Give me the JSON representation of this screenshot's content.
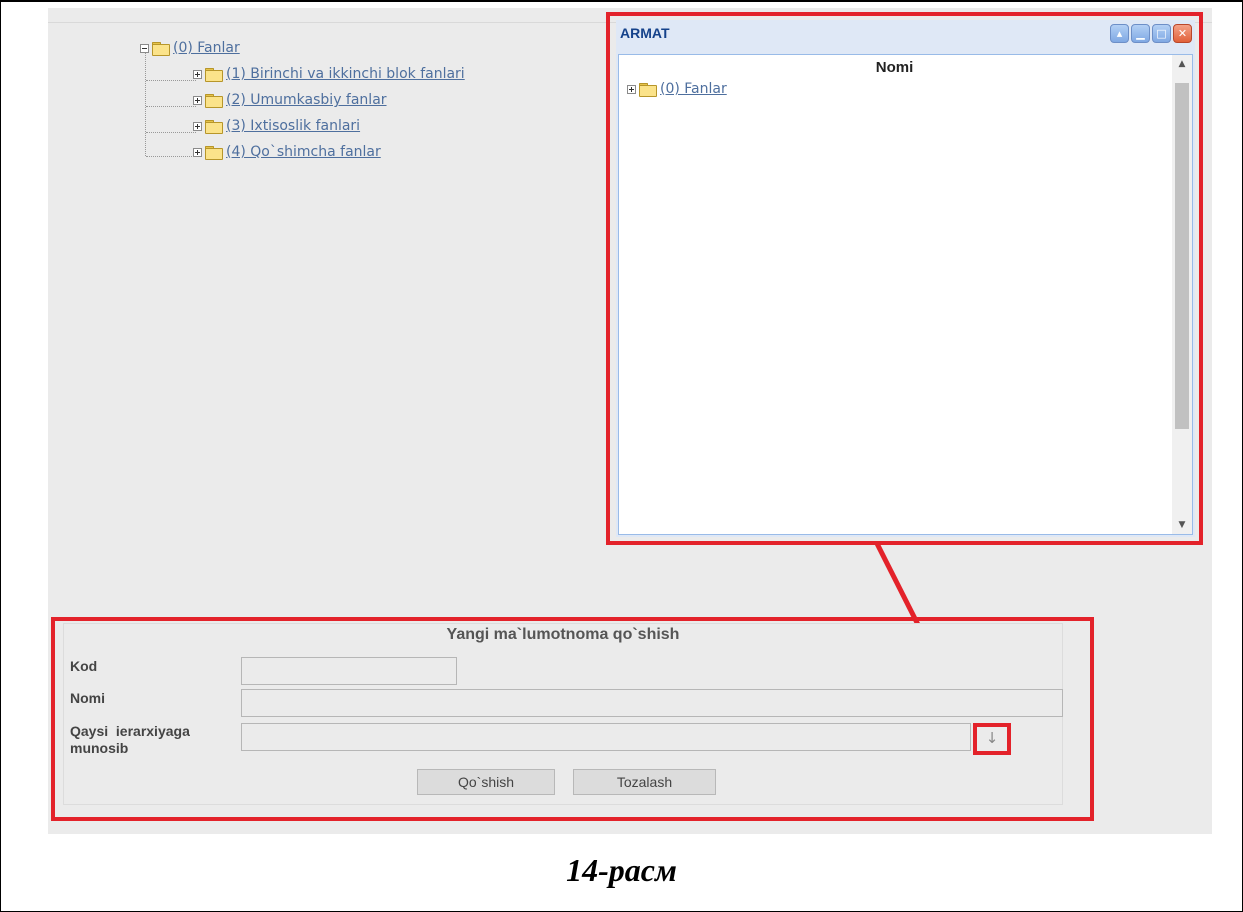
{
  "tree": {
    "root_label": "(0) Fanlar",
    "children": [
      {
        "label": "(1) Birinchi va ikkinchi blok fanlari"
      },
      {
        "label": "(2) Umumkasbiy fanlar"
      },
      {
        "label": "(3) Ixtisoslik fanlari"
      },
      {
        "label": "(4) Qo`shimcha fanlar"
      }
    ]
  },
  "popup": {
    "title": "ARMAT",
    "column_header": "Nomi",
    "root_label": "(0) Fanlar",
    "buttons": [
      "restore-icon",
      "minimize-icon",
      "maximize-icon",
      "close-icon"
    ]
  },
  "form": {
    "title": "Yangi ma`lumotnoma qo`shish",
    "kod_label": "Kod",
    "nomi_label": "Nomi",
    "ierarxiya_label_line1": "Qaysi  ierarxiyaga",
    "ierarxiya_label_line2": "munosib",
    "dropdown_glyph": "↓",
    "add_button": "Qo`shish",
    "clear_button": "Tozalash"
  },
  "caption": "14-расм",
  "colors": {
    "highlight": "#e3222a",
    "link": "#4e6f9e",
    "window_title": "#15428b"
  }
}
